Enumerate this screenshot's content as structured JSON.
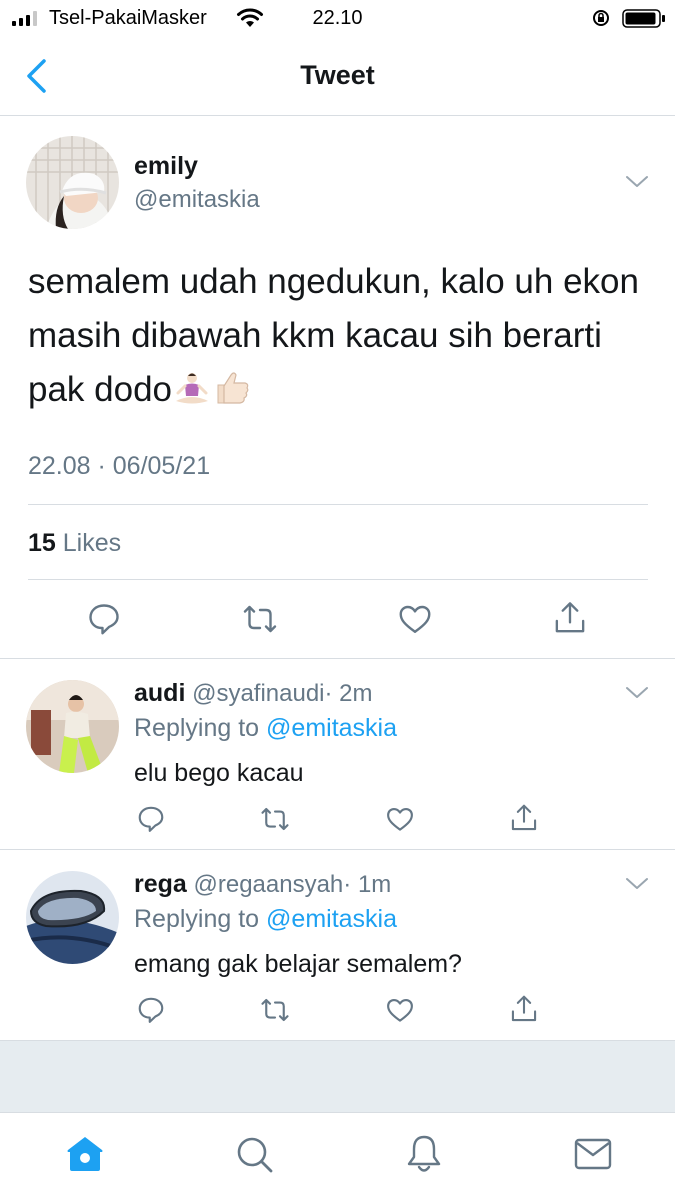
{
  "status_bar": {
    "carrier": "Tsel-PakaiMasker",
    "time": "22.10"
  },
  "nav": {
    "title": "Tweet",
    "back_icon": "chevron-left-icon"
  },
  "tweet": {
    "name": "emily",
    "handle": "@emitaskia",
    "text": "semalem udah ngedukun, kalo uh ekon masih dibawah kkm kacau sih berarti pak dodo",
    "emojis": [
      "🧘🏻‍♀️",
      "👍🏻"
    ],
    "timestamp": "22.08 · 06/05/21",
    "likes_count": "15",
    "likes_label": "Likes"
  },
  "replies": [
    {
      "name": "audi",
      "handle": "@syafinaudi",
      "time": "· 2m",
      "replying_label": "Replying to",
      "replying_to": "@emitaskia",
      "text": "elu bego kacau"
    },
    {
      "name": "rega",
      "handle": "@regaansyah",
      "time": "· 1m",
      "replying_label": "Replying to",
      "replying_to": "@emitaskia",
      "text": "emang gak belajar semalem?"
    }
  ],
  "colors": {
    "accent": "#1da1f2",
    "secondary_text": "#657786",
    "primary_text": "#14171a",
    "divider": "#d8dde2"
  },
  "tab_bar": [
    "home-icon",
    "search-icon",
    "notifications-bell-icon",
    "messages-envelope-icon"
  ]
}
